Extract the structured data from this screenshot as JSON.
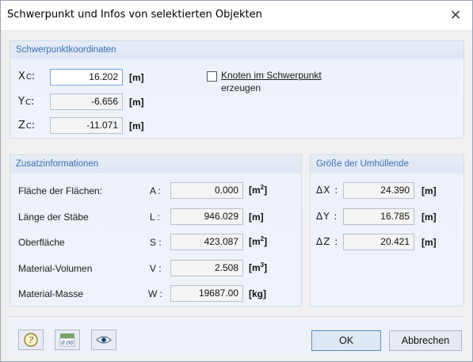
{
  "window": {
    "title": "Schwerpunkt und Infos von selektierten Objekten",
    "close_glyph": "×"
  },
  "schwerpunkt": {
    "group_label": "Schwerpunktkoordinaten",
    "rows": [
      {
        "axis": "X",
        "sub": "C",
        "value": "16.202",
        "unit": "[m]"
      },
      {
        "axis": "Y",
        "sub": "C",
        "value": "-6.656",
        "unit": "[m]"
      },
      {
        "axis": "Z",
        "sub": "C",
        "value": "-11.071",
        "unit": "[m]"
      }
    ],
    "checkbox_line1": "Knoten im Schwerpunkt",
    "checkbox_line2": "erzeugen",
    "checkbox_checked": false
  },
  "zusatz": {
    "group_label": "Zusatzinformationen",
    "rows": [
      {
        "label": "Fläche der Flächen:",
        "sym": "A :",
        "value": "0.000",
        "unit": "[m",
        "sup": "2",
        "unit_end": "]"
      },
      {
        "label": "Länge der Stäbe",
        "sym": "L :",
        "value": "946.029",
        "unit": "[m]",
        "sup": "",
        "unit_end": ""
      },
      {
        "label": "Oberfläche",
        "sym": "S :",
        "value": "423.087",
        "unit": "[m",
        "sup": "2",
        "unit_end": "]"
      },
      {
        "label": "Material-Volumen",
        "sym": "V :",
        "value": "2.508",
        "unit": "[m",
        "sup": "3",
        "unit_end": "]"
      },
      {
        "label": "Material-Masse",
        "sym": "W :",
        "value": "19687.00",
        "unit": "[kg]",
        "sup": "",
        "unit_end": ""
      }
    ]
  },
  "umhuellende": {
    "group_label": "Größe der Umhüllende",
    "rows": [
      {
        "delta": "Δ",
        "axis": "X",
        "colon": " :",
        "value": "24.390",
        "unit": "[m]"
      },
      {
        "delta": "Δ",
        "axis": "Y",
        "colon": " :",
        "value": "16.785",
        "unit": "[m]"
      },
      {
        "delta": "Δ",
        "axis": "Z",
        "colon": " :",
        "value": "20.421",
        "unit": "[m]"
      }
    ]
  },
  "footer": {
    "ok_label": "OK",
    "cancel_label": "Abbrechen",
    "calc_icon_text": "0.00",
    "icons": [
      "help-icon",
      "calculator-icon",
      "eye-icon"
    ]
  },
  "colors": {
    "group_label": "#3d6eb5",
    "group_bg": "#eef2f9",
    "ok_border": "#5b88c7"
  }
}
